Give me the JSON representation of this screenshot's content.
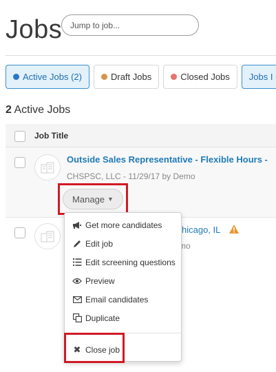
{
  "page": {
    "title": "Jobs"
  },
  "search": {
    "placeholder": "Jump to job..."
  },
  "tabs": [
    {
      "label": "Active Jobs (2)",
      "dot_color": "#2b78c5"
    },
    {
      "label": "Draft Jobs",
      "dot_color": "#d7954a"
    },
    {
      "label": "Closed Jobs",
      "dot_color": "#e8736c"
    },
    {
      "label": "Jobs I C"
    }
  ],
  "summary": {
    "count": "2",
    "label": "Active Jobs"
  },
  "table": {
    "column_title": "Job Title"
  },
  "jobs": [
    {
      "title": "Outside Sales Representative - Flexible Hours -",
      "meta": "CHSPSC, LLC - 11/29/17 by Demo"
    },
    {
      "title_fragment": "hicago, IL",
      "meta_fragment": "mo",
      "warning_icon": "warning-icon"
    }
  ],
  "manage": {
    "label": "Manage"
  },
  "menu": {
    "items": [
      {
        "label": "Get more candidates",
        "icon": "megaphone-icon"
      },
      {
        "label": "Edit job",
        "icon": "pencil-icon"
      },
      {
        "label": "Edit screening questions",
        "icon": "list-icon"
      },
      {
        "label": "Preview",
        "icon": "eye-icon"
      },
      {
        "label": "Email candidates",
        "icon": "envelope-icon"
      },
      {
        "label": "Duplicate",
        "icon": "copy-icon"
      }
    ],
    "close_label": "Close job",
    "close_icon": "close-icon"
  },
  "colors": {
    "link": "#1f7ab8",
    "highlight": "#d11a25",
    "warning": "#e8962e",
    "active_tab_bg": "#e3f1fb"
  }
}
